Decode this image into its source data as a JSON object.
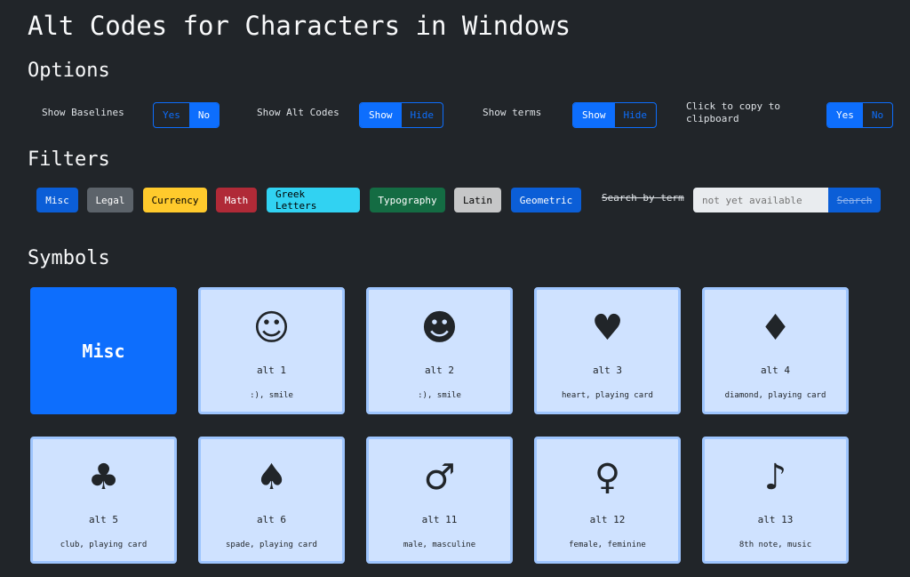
{
  "title": "Alt Codes for Characters in Windows",
  "options": {
    "heading": "Options",
    "baselines": {
      "label": "Show Baselines",
      "yes": "Yes",
      "no": "No",
      "selected": "No"
    },
    "alt_codes": {
      "label": "Show Alt Codes",
      "show": "Show",
      "hide": "Hide",
      "selected": "Show"
    },
    "terms": {
      "label": "Show terms",
      "show": "Show",
      "hide": "Hide",
      "selected": "Show"
    },
    "clipboard": {
      "label": "Click to copy to clipboard",
      "yes": "Yes",
      "no": "No",
      "selected": "Yes"
    }
  },
  "filters": {
    "heading": "Filters",
    "items": [
      {
        "label": "Misc",
        "bg": "#0b5ed7",
        "fg": "#ffffff"
      },
      {
        "label": "Legal",
        "bg": "#5c636a",
        "fg": "#ffffff"
      },
      {
        "label": "Currency",
        "bg": "#ffca2c",
        "fg": "#000000"
      },
      {
        "label": "Math",
        "bg": "#b02a37",
        "fg": "#ffffff"
      },
      {
        "label": "Greek Letters",
        "bg": "#31d2f2",
        "fg": "#000000"
      },
      {
        "label": "Typography",
        "bg": "#146c43",
        "fg": "#ffffff"
      },
      {
        "label": "Latin",
        "bg": "#c6c7c8",
        "fg": "#000000"
      },
      {
        "label": "Geometric",
        "bg": "#0b5ed7",
        "fg": "#ffffff"
      }
    ],
    "search_label": "Search by term",
    "search_placeholder": "not yet available",
    "search_button": "Search"
  },
  "symbols": {
    "heading": "Symbols",
    "category": "Misc",
    "items": [
      {
        "symbol": "☺",
        "code": "alt 1",
        "terms": ":), smile"
      },
      {
        "symbol": "☻",
        "code": "alt 2",
        "terms": ":), smile"
      },
      {
        "symbol": "♥",
        "code": "alt 3",
        "terms": "heart, playing card"
      },
      {
        "symbol": "♦",
        "code": "alt 4",
        "terms": "diamond, playing card"
      },
      {
        "symbol": "♣",
        "code": "alt 5",
        "terms": "club, playing card"
      },
      {
        "symbol": "♠",
        "code": "alt 6",
        "terms": "spade, playing card"
      },
      {
        "symbol": "♂",
        "code": "alt 11",
        "terms": "male, masculine"
      },
      {
        "symbol": "♀",
        "code": "alt 12",
        "terms": "female, feminine"
      },
      {
        "symbol": "♪",
        "code": "alt 13",
        "terms": "8th note, music"
      }
    ]
  }
}
